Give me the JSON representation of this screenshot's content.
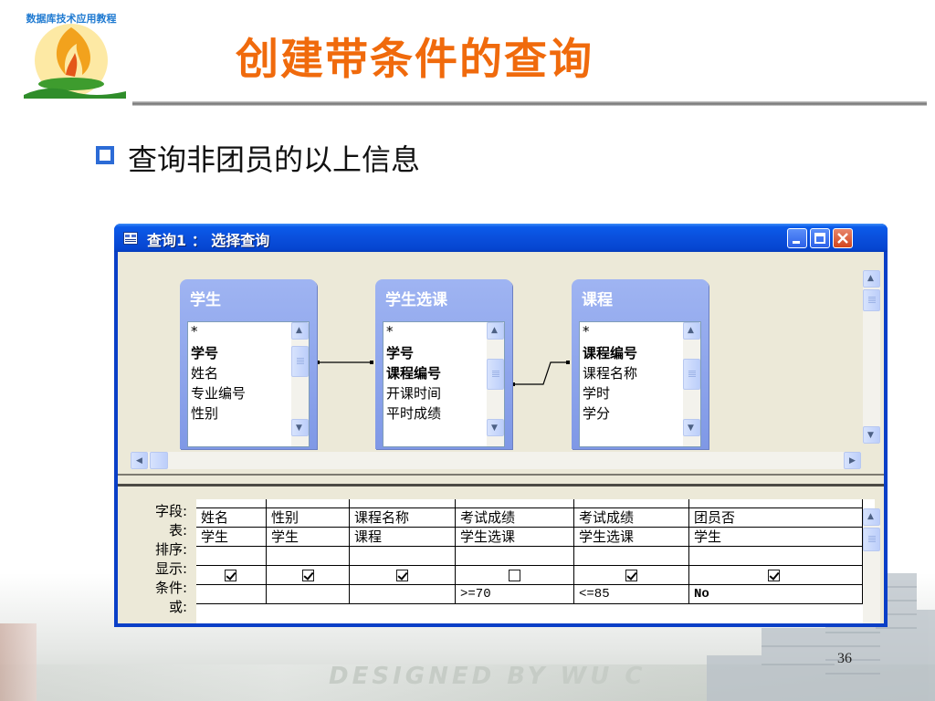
{
  "slide": {
    "title": "创建带条件的查询",
    "bullet_text": "查询非团员的以上信息",
    "page_number": "36",
    "logo_text": "数据库技术应用教程",
    "watermark_text": "DESIGNED BY WU C"
  },
  "window": {
    "title": "查询1 ： 选择查询",
    "controls": [
      "minimize",
      "maximize",
      "close"
    ]
  },
  "tables": [
    {
      "name": "学生",
      "fields": [
        {
          "label": "*",
          "bold": false
        },
        {
          "label": "学号",
          "bold": true
        },
        {
          "label": "姓名",
          "bold": false
        },
        {
          "label": "专业编号",
          "bold": false
        },
        {
          "label": "性别",
          "bold": false
        }
      ]
    },
    {
      "name": "学生选课",
      "fields": [
        {
          "label": "*",
          "bold": false
        },
        {
          "label": "学号",
          "bold": true
        },
        {
          "label": "课程编号",
          "bold": true
        },
        {
          "label": "开课时间",
          "bold": false
        },
        {
          "label": "平时成绩",
          "bold": false
        }
      ]
    },
    {
      "name": "课程",
      "fields": [
        {
          "label": "*",
          "bold": false
        },
        {
          "label": "课程编号",
          "bold": true
        },
        {
          "label": "课程名称",
          "bold": false
        },
        {
          "label": "学时",
          "bold": false
        },
        {
          "label": "学分",
          "bold": false
        }
      ]
    }
  ],
  "grid": {
    "row_labels": [
      "字段:",
      "表:",
      "排序:",
      "显示:",
      "条件:",
      "或:"
    ],
    "columns": [
      {
        "field": "姓名",
        "table": "学生",
        "sort": "",
        "show": true,
        "criteria": ""
      },
      {
        "field": "性别",
        "table": "学生",
        "sort": "",
        "show": true,
        "criteria": ""
      },
      {
        "field": "课程名称",
        "table": "课程",
        "sort": "",
        "show": true,
        "criteria": ""
      },
      {
        "field": "考试成绩",
        "table": "学生选课",
        "sort": "",
        "show": false,
        "criteria": ">=70"
      },
      {
        "field": "考试成绩",
        "table": "学生选课",
        "sort": "",
        "show": true,
        "criteria": "<=85"
      },
      {
        "field": "团员否",
        "table": "学生",
        "sort": "",
        "show": true,
        "criteria": "No"
      }
    ]
  },
  "colors": {
    "title": "#f06a0c",
    "window_frame": "#0a3fc7",
    "table_header": "#8aa3ec",
    "bullet": "#2c6bd6"
  }
}
